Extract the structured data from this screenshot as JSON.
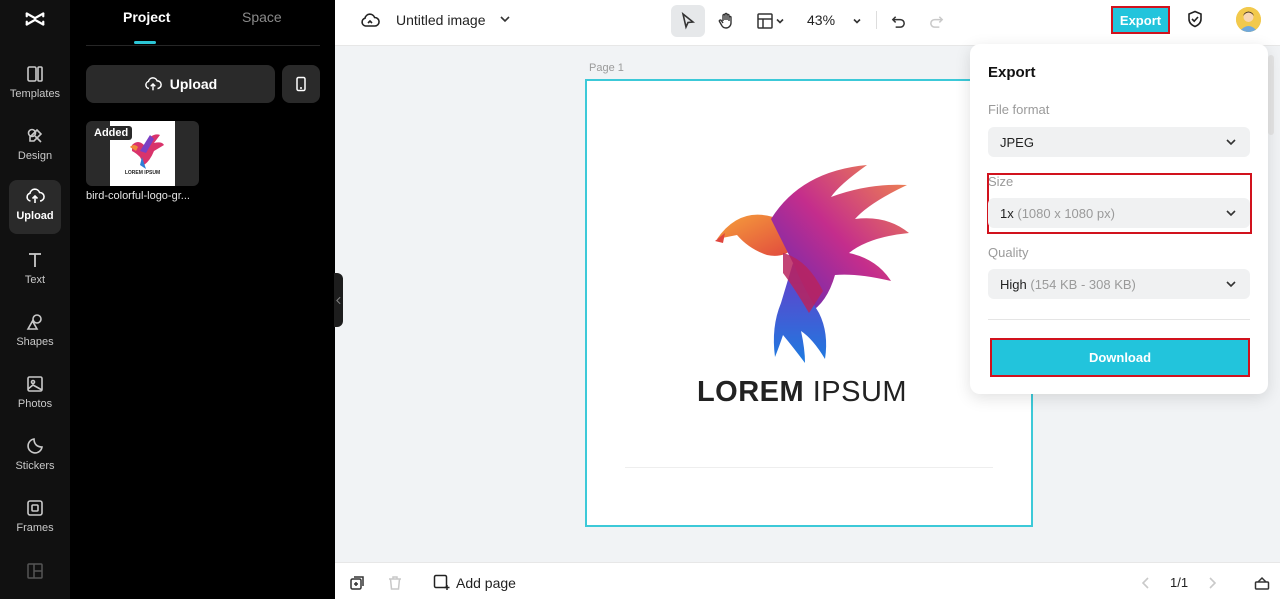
{
  "rail": {
    "items": [
      {
        "label": "Templates",
        "icon": "templates-icon"
      },
      {
        "label": "Design",
        "icon": "design-icon"
      },
      {
        "label": "Upload",
        "icon": "upload-cloud-icon",
        "active": true
      },
      {
        "label": "Text",
        "icon": "text-icon"
      },
      {
        "label": "Shapes",
        "icon": "shapes-icon"
      },
      {
        "label": "Photos",
        "icon": "photos-icon"
      },
      {
        "label": "Stickers",
        "icon": "stickers-icon"
      },
      {
        "label": "Frames",
        "icon": "frames-icon"
      }
    ]
  },
  "panel": {
    "tabs": [
      "Project",
      "Space"
    ],
    "upload_label": "Upload",
    "asset": {
      "badge": "Added",
      "name": "bird-colorful-logo-gr..."
    }
  },
  "topbar": {
    "title": "Untitled image",
    "zoom": "43%",
    "export_label": "Export"
  },
  "canvas": {
    "page_label": "Page 1",
    "logo_text_bold": "LOREM",
    "logo_text_light": "IPSUM"
  },
  "export_panel": {
    "title": "Export",
    "file_format_label": "File format",
    "file_format_value": "JPEG",
    "size_label": "Size",
    "size_value": "1x",
    "size_detail": "(1080 x 1080 px)",
    "quality_label": "Quality",
    "quality_value": "High",
    "quality_detail": "(154 KB - 308 KB)",
    "download_label": "Download"
  },
  "bottombar": {
    "add_page_label": "Add page",
    "page_count": "1/1"
  },
  "colors": {
    "accent": "#22c4dc",
    "highlight": "#d1121d",
    "rail_bg": "#111111"
  }
}
